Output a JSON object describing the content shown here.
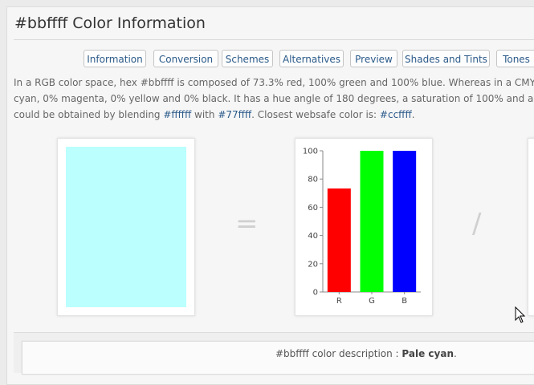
{
  "page": {
    "title": "#bbffff Color Information"
  },
  "tabs": [
    {
      "label": "Information"
    },
    {
      "label": "Conversion"
    },
    {
      "label": "Schemes"
    },
    {
      "label": "Alternatives"
    },
    {
      "label": "Preview"
    },
    {
      "label": "Shades and Tints"
    },
    {
      "label": "Tones"
    }
  ],
  "description": {
    "line1": "In a RGB color space, hex #bbffff is composed of 73.3% red, 100% green and 100% blue. Whereas in a CMYK",
    "line2": "cyan, 0% magenta, 0% yellow and 0% black. It has a hue angle of 180 degrees, a saturation of 100% and a",
    "line3_prefix": "could be obtained by blending ",
    "blend_color_1": "#ffffff",
    "line3_with": " with ",
    "blend_color_2": "#77ffff",
    "line3_websafe": ". Closest websafe color is: ",
    "websafe_color": "#ccffff",
    "line3_end": "."
  },
  "swatch": {
    "color": "#bbffff"
  },
  "operators": {
    "equals": "=",
    "slash": "/"
  },
  "chart_data": {
    "type": "bar",
    "categories": [
      "R",
      "G",
      "B"
    ],
    "values": [
      73.3,
      100,
      100
    ],
    "colors": [
      "#ff0000",
      "#00ff00",
      "#0000ff"
    ],
    "ylim": [
      0,
      100
    ],
    "yticks": [
      0,
      20,
      40,
      60,
      80,
      100
    ],
    "grid": false
  },
  "footer": {
    "prefix": "#bbffff color description : ",
    "name": "Pale cyan",
    "suffix": "."
  }
}
